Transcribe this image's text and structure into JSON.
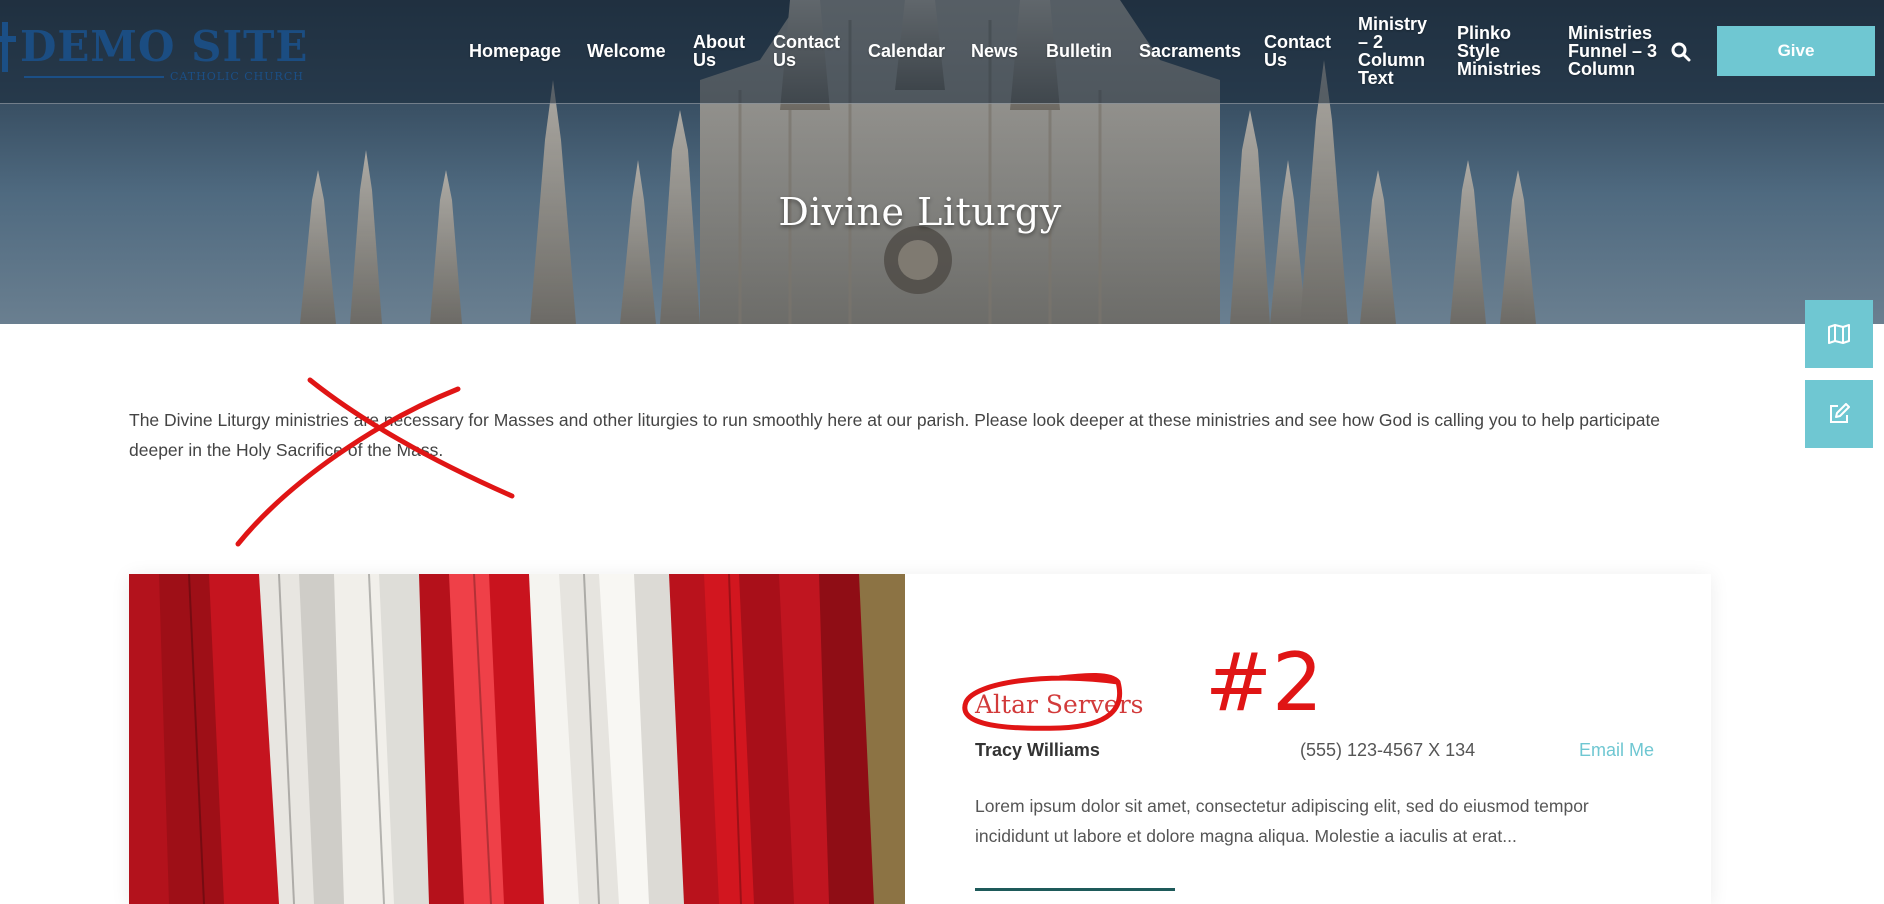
{
  "header": {
    "logo_text": "DEMO SITE",
    "logo_subtext": "CATHOLIC CHURCH",
    "nav": [
      {
        "label": "Homepage"
      },
      {
        "label": "Welcome"
      },
      {
        "label": "About Us"
      },
      {
        "label": "Contact Us"
      },
      {
        "label": "Calendar"
      },
      {
        "label": "News"
      },
      {
        "label": "Bulletin"
      },
      {
        "label": "Sacraments"
      },
      {
        "label": "Contact Us"
      },
      {
        "label": "Ministry – 2 Column Text"
      },
      {
        "label": "Plinko Style Ministries"
      },
      {
        "label": "Ministries Funnel – 3 Column"
      }
    ],
    "search_icon": "search-icon",
    "give_label": "Give"
  },
  "hero": {
    "title": "Divine Liturgy"
  },
  "side_buttons": [
    {
      "icon": "map-icon"
    },
    {
      "icon": "edit-icon"
    }
  ],
  "intro": {
    "text": "The Divine Liturgy ministries are necessary for Masses and other liturgies to run smoothly here at our parish. Please look deeper at these ministries and see how God is calling you to help participate deeper in the Holy Sacrifice of the Mass."
  },
  "ministry": {
    "title": "Altar Servers",
    "contact_name": "Tracy Williams",
    "phone": "(555) 123-4567 X 134",
    "email_label": "Email Me",
    "description": "Lorem ipsum dolor sit amet, consectetur adipiscing elit, sed do eiusmod tempor incididunt ut labore et dolore magna aliqua. Molestie a iaculis at erat..."
  },
  "annotations": {
    "number_label": "#2"
  },
  "colors": {
    "accent": "#6fc7d2",
    "title_red": "#d23a3a",
    "annotation_red": "#e01515",
    "logo_blue": "#1b4f86"
  }
}
